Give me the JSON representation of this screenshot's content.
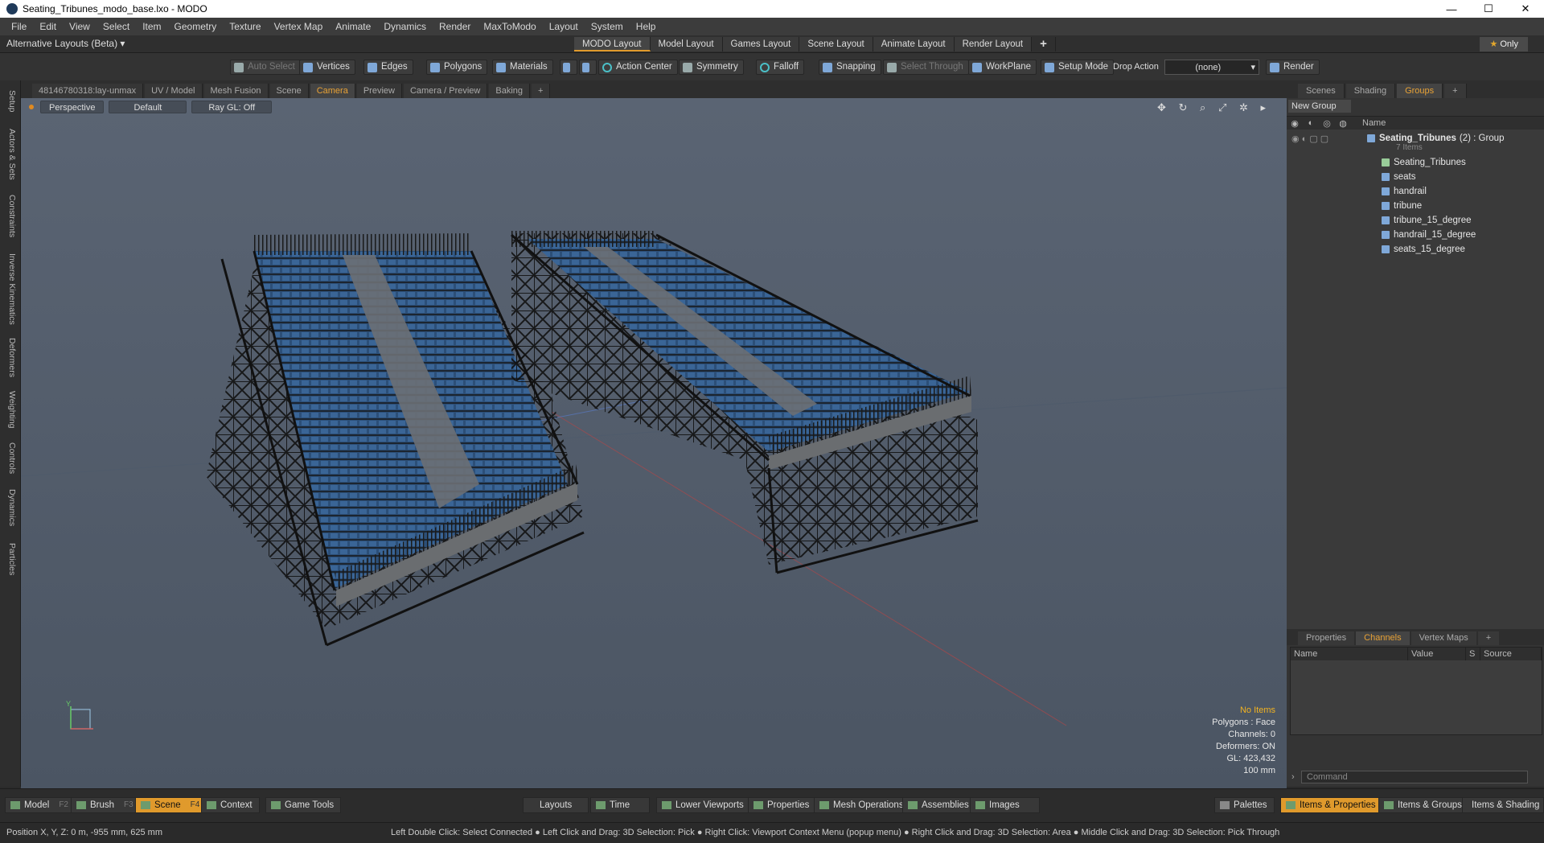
{
  "window": {
    "title": "Seating_Tribunes_modo_base.lxo - MODO",
    "minimize": "—",
    "maximize": "☐",
    "close": "✕"
  },
  "menu": [
    "File",
    "Edit",
    "View",
    "Select",
    "Item",
    "Geometry",
    "Texture",
    "Vertex Map",
    "Animate",
    "Dynamics",
    "Render",
    "MaxToModo",
    "Layout",
    "System",
    "Help"
  ],
  "layout_bar": {
    "alt_layouts": "Alternative Layouts (Beta) ▾",
    "tabs": [
      "MODO Layout",
      "Model Layout",
      "Games Layout",
      "Scene Layout",
      "Animate Layout",
      "Render Layout"
    ],
    "active_tab": "MODO Layout",
    "add": "+",
    "only": "Only"
  },
  "toolbar": {
    "auto_select": "Auto Select",
    "vertices": "Vertices",
    "edges": "Edges",
    "polygons": "Polygons",
    "materials": "Materials",
    "action_center": "Action Center",
    "symmetry": "Symmetry",
    "falloff": "Falloff",
    "snapping": "Snapping",
    "select_through": "Select Through",
    "workplane": "WorkPlane",
    "setup_mode": "Setup Mode",
    "drop_action": "Drop Action",
    "drop_value": "(none)",
    "render": "Render"
  },
  "left_tabs": [
    "Setup",
    "Actors & Sets",
    "Constraints",
    "Inverse Kinematics",
    "Deformers",
    "Weighting",
    "Controls",
    "Dynamics",
    "Particles"
  ],
  "viewport_tabs": [
    "48146780318:lay-unmax",
    "UV / Model",
    "Mesh Fusion",
    "Scene",
    "Camera",
    "Preview",
    "Camera / Preview",
    "Baking",
    "+"
  ],
  "viewport": {
    "perspective": "Perspective",
    "default": "Default",
    "raygl": "Ray GL: Off",
    "controls": "✥ ↻ ⌕ ⤢ ✲ ▸",
    "info": {
      "items": "No Items",
      "polygons": "Polygons : Face",
      "channels": "Channels: 0",
      "deformers": "Deformers: ON",
      "gl": "GL: 423,432",
      "scale": "100 mm"
    },
    "axis_y": "Y"
  },
  "right_panel": {
    "tabs": [
      "Scenes",
      "Shading",
      "Groups",
      "+"
    ],
    "active": "Groups",
    "new_group": "New Group",
    "col_name": "Name",
    "group_name": "Seating_Tribunes",
    "group_meta": "(2) : Group",
    "group_count": "7 Items",
    "items": [
      "Seating_Tribunes",
      "seats",
      "handrail",
      "tribune",
      "tribune_15_degree",
      "handrail_15_degree",
      "seats_15_degree"
    ],
    "bottom_tabs": [
      "Properties",
      "Channels",
      "Vertex Maps",
      "+"
    ],
    "bottom_active": "Channels",
    "chan_cols": [
      "Name",
      "Value",
      "S",
      "Source"
    ],
    "command": "Command"
  },
  "bottom_bar": {
    "model": "Model",
    "model_key": "F2",
    "brush": "Brush",
    "brush_key": "F3",
    "scene": "Scene",
    "scene_key": "F4",
    "context": "Context",
    "game_tools": "Game Tools",
    "layouts": "Layouts",
    "time": "Time",
    "lower_viewports": "Lower Viewports",
    "properties": "Properties",
    "mesh_operations": "Mesh Operations",
    "assemblies": "Assemblies",
    "images": "Images",
    "palettes": "Palettes",
    "items_properties": "Items & Properties",
    "items_groups": "Items & Groups",
    "items_shading": "Items & Shading"
  },
  "status": {
    "position": "Position X, Y, Z:   0 m, -955 mm, 625 mm",
    "hint": "Left Double Click: Select Connected ● Left Click and Drag: 3D Selection: Pick ● Right Click: Viewport Context Menu (popup menu) ● Right Click and Drag: 3D Selection: Area ● Middle Click and Drag: 3D Selection: Pick Through"
  }
}
